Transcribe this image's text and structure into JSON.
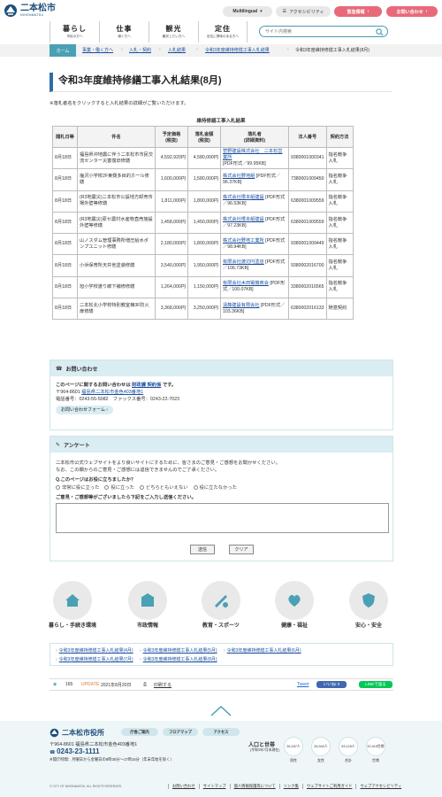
{
  "header": {
    "logo_text": "二本松市",
    "logo_sub": "NIHONMATSU",
    "multilingual_label": "Multilingual",
    "accessibility_label": "アクセシビリティ",
    "emergency_label": "緊急情報",
    "contact_label": "お問い合わせ",
    "gnav": [
      {
        "main": "暮らし",
        "sub": "市民の方へ"
      },
      {
        "main": "仕事",
        "sub": "働く方へ"
      },
      {
        "main": "観光",
        "sub": "観光したい方へ"
      },
      {
        "main": "定住",
        "sub": "定住に興味のある方へ"
      }
    ],
    "search_placeholder": "サイト内検索"
  },
  "breadcrumb": {
    "home": "ホーム",
    "items": [
      "事業・働く方へ",
      "入札・契約",
      "入札結果",
      "令和3年度維持修繕工事入札結果"
    ],
    "current": "令和3年度維持修繕工事入札結果(8月)"
  },
  "page": {
    "title": "令和3年度維持修繕工事入札結果(8月)",
    "note": "※落札者名をクリックすると入札結果の詳細がご覧いただけます。"
  },
  "table": {
    "caption": "維持修繕工事入札結果",
    "headers": [
      "開札日等",
      "件名",
      "予定価格\n(税抜)",
      "落札金額\n(税抜)",
      "落札者\n(詳細資料)",
      "法人番号",
      "契約方法"
    ],
    "rows": [
      {
        "date": "8月18日",
        "name": "福島県沖地震に伴う二本松市市民交流センター災害復旧修繕",
        "planned": "4,592,920円",
        "awarded": "4,580,000円",
        "winner": "菅野建設株式会社　二本松営業所",
        "pdf": "[PDF形式／99.95KB]",
        "corp": "9380001000341",
        "method": "指名競争入札"
      },
      {
        "date": "8月18日",
        "name": "塩沢小学校2F東側多目的ホール修繕",
        "planned": "1,600,000円",
        "awarded": "1,580,000円",
        "winner": "株式会社野地組",
        "pdf": "[PDF形式／96.37KB]",
        "corp": "7380001009450",
        "method": "指名競争入札"
      },
      {
        "date": "8月18日",
        "name": "(R3地震災)二本松市公設地方卸売市場外壁等修繕",
        "planned": "1,811,000円",
        "awarded": "1,800,000円",
        "winner": "株式会社根本組建設",
        "pdf": "[PDF形式／96.53KB]",
        "corp": "6380001009559",
        "method": "指名競争入札"
      },
      {
        "date": "8月18日",
        "name": "(R3地震災)原セ農村水産物直売施設外壁等修繕",
        "planned": "1,458,000円",
        "awarded": "1,450,000円",
        "winner": "株式会社根本組建設",
        "pdf": "[PDF形式／97.23KB]",
        "corp": "6380001009559",
        "method": "指名競争入札"
      },
      {
        "date": "8月18日",
        "name": "山ノスダム管理事務所増圧給水ポンプユニット修繕",
        "planned": "2,180,000円",
        "awarded": "1,800,000円",
        "winner": "株式会社野地工業所",
        "pdf": "[PDF形式／98.94KB]",
        "corp": "9380001009449",
        "method": "指名競争入札"
      },
      {
        "date": "8月18日",
        "name": "小浜保育所天井他塗装修繕",
        "planned": "3,540,000円",
        "awarded": "1,950,000円",
        "winner": "有限会社渡辺円塗店",
        "pdf": "[PDF形式／106.73KB]",
        "corp": "9380002016700",
        "method": "指名競争入札"
      },
      {
        "date": "8月18日",
        "name": "旭小学校渡り廊下補修修繕",
        "planned": "1,264,000円",
        "awarded": "1,150,000円",
        "winner": "有限会社木田電機商会",
        "pdf": "[PDF形式／100.07KB]",
        "corp": "3380002016565",
        "method": "指名競争入札"
      },
      {
        "date": "8月18日",
        "name": "二本松北小学校特別教室棟3F防火扉修繕",
        "planned": "3,368,000円",
        "awarded": "3,250,000円",
        "winner": "遠藤建設有限会社",
        "pdf": "[PDF形式／103.36KB]",
        "corp": "6380002016133",
        "method": "随意契約"
      }
    ]
  },
  "contact": {
    "heading": "お問い合わせ",
    "lead_prefix": "このページに関するお問い合わせは ",
    "dept": "財政課 契約係",
    "lead_suffix": " です。",
    "postal": "〒964-8601",
    "address": "福島県二本松市金色403番地1",
    "phone": "電話番号：0243-55-5082　ファックス番号：0243-22-7023",
    "form_button": "お問い合わせフォーム"
  },
  "survey": {
    "heading": "アンケート",
    "intro1": "二本松市公式ウェブサイトをより良いサイトにするために、皆さまのご意見・ご感想をお聞かせください。",
    "intro2": "なお、この欄からのご意見・ご感想には返信できませんのでご了承ください。",
    "question": "Q.このページはお役に立ちましたか？",
    "options": [
      "非常に役に立った",
      "役に立った",
      "どちらともいえない",
      "役に立たなかった"
    ],
    "comment_label": "ご意見・ご感想等がございましたら下記をご入力し送信ください。",
    "submit": "送信",
    "clear": "クリア"
  },
  "categories": [
    {
      "label": "暮らし・手続き環境",
      "icon": "home-icon"
    },
    {
      "label": "市政情報",
      "icon": "city-hall-icon"
    },
    {
      "label": "教育・スポーツ",
      "icon": "education-icon"
    },
    {
      "label": "健康・福祉",
      "icon": "health-icon"
    },
    {
      "label": "安心・安全",
      "icon": "safety-icon"
    }
  ],
  "related": [
    "令和3年度維持修繕工事入札結果(4月)",
    "令和3年度維持修繕工事入札結果(5月)",
    "令和3年度維持修繕工事入札結果(6月)",
    "令和3年度維持修繕工事入札結果(7月)",
    "令和3年度維持修繕工事入札結果(8月)"
  ],
  "stats": {
    "views": "165",
    "update_label": "UPDATE",
    "date": "2021年8月20日",
    "print": "印刷する",
    "tweet": "Tweet",
    "facebook": "いいね! 0",
    "line": "LINEで送る"
  },
  "footer": {
    "name": "二本松市役所",
    "buttons": [
      "庁舎ご案内",
      "フロアマップ",
      "アクセス"
    ],
    "postal_address": "〒964-8601 福島県二本松市金色403番地1",
    "tel": "0243-23-1111",
    "hours": "※開庁時間：月曜日から金曜日の8時30分～17時15分（年末年始を除く）",
    "pop_title": "人口と世帯",
    "pop_sub": "(令和3年7月末現在)",
    "population": [
      {
        "value": "26,187人",
        "label": "男性"
      },
      {
        "value": "26,942人",
        "label": "女性"
      },
      {
        "value": "53,129人",
        "label": "合計"
      },
      {
        "value": "20,319世帯",
        "label": "世帯"
      }
    ],
    "copyright": "© CITY OF NIHONMATSU. ALL RIGHTS RESERVED.",
    "links": [
      "お問い合わせ",
      "サイトマップ",
      "個人情報保護等について",
      "リンク集",
      "ウェブサイトご利用ガイド",
      "ウェブアクセシビリティ"
    ]
  },
  "colors": {
    "accent": "#4aa0b4",
    "brand": "#1f4f7a",
    "alert": "#e86a7a"
  }
}
